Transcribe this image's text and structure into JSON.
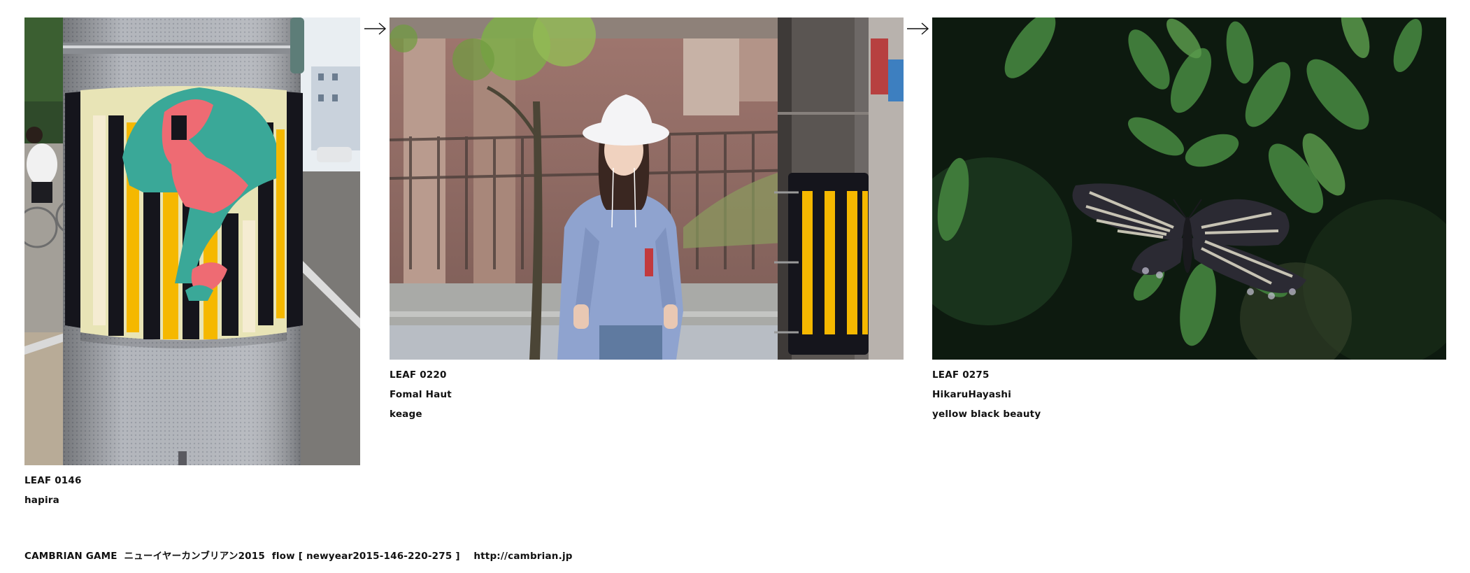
{
  "leaves": [
    {
      "code": "LEAF 0146",
      "lines": [
        "hapira"
      ],
      "photo": "pole-with-striped-sticker"
    },
    {
      "code": "LEAF 0220",
      "lines": [
        "Fomal Haut",
        "keage"
      ],
      "photo": "woman-in-white-hat"
    },
    {
      "code": "LEAF 0275",
      "lines": [
        "HikaruHayashi",
        "yellow black beauty"
      ],
      "photo": "butterfly-on-leaves"
    }
  ],
  "arrows": [
    "arrow-right-icon",
    "arrow-right-icon"
  ],
  "footer": "CAMBRIAN GAME  ニューイヤーカンブリアン2015  flow [ newyear2015-146-220-275 ]    http://cambrian.jp",
  "colors": {
    "background": "#ffffff",
    "text": "#111111",
    "stripe_yellow": "#f5b800",
    "stripe_black": "#15151c"
  }
}
